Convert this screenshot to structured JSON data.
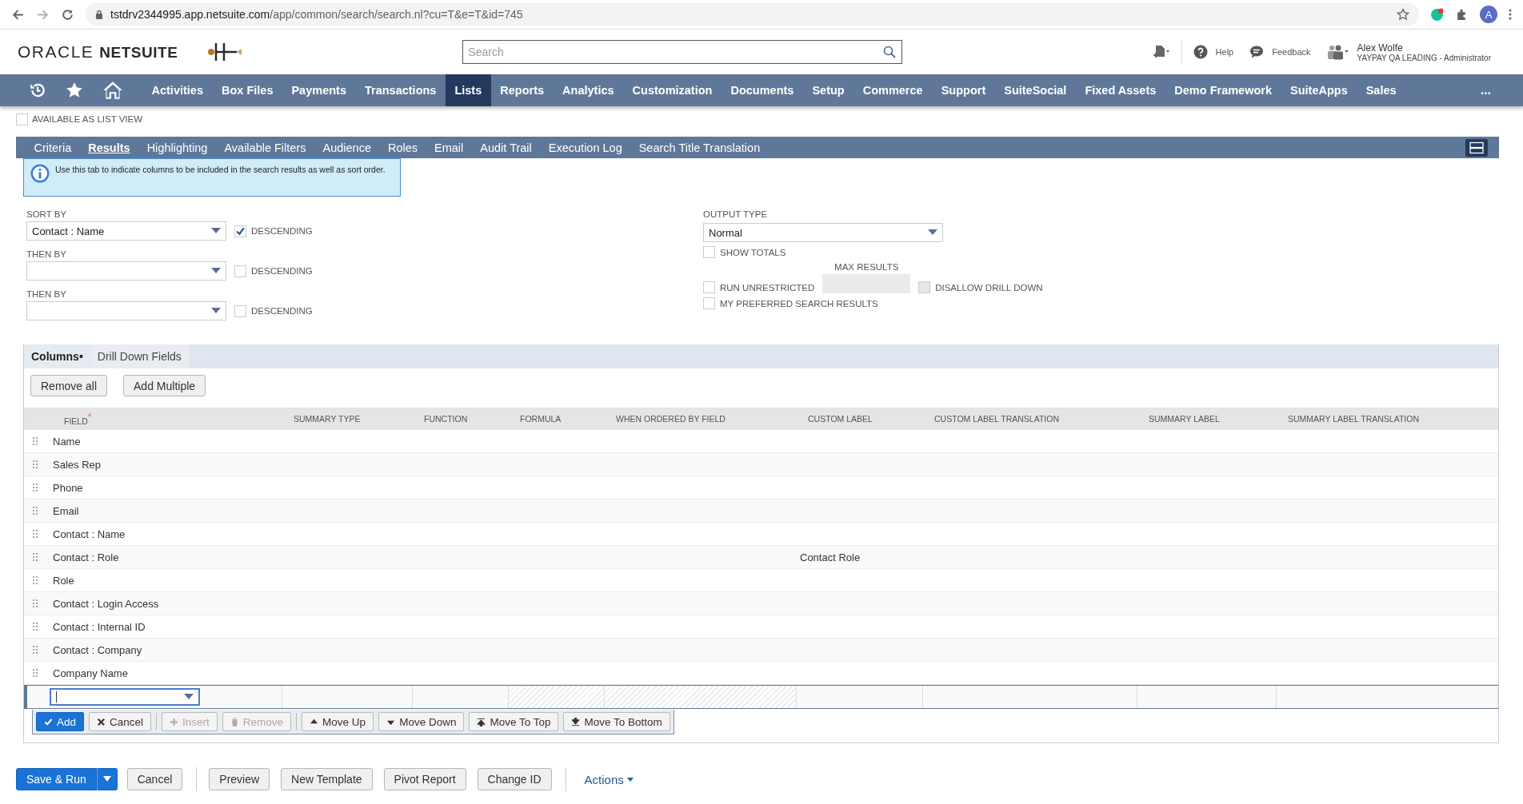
{
  "browser": {
    "url_host": "tstdrv2344995.app.netsuite.com",
    "url_path": "/app/common/search/search.nl?cu=T&e=T&id=745",
    "profile_initial": "A"
  },
  "header": {
    "brand_left": "ORACLE",
    "brand_right": "NETSUITE",
    "search_placeholder": "Search",
    "help": "Help",
    "feedback": "Feedback",
    "user_name": "Alex Wolfe",
    "user_role": "YAYPAY QA LEADING - Administrator"
  },
  "nav": [
    {
      "label": "Activities",
      "selected": false
    },
    {
      "label": "Box Files",
      "selected": false
    },
    {
      "label": "Payments",
      "selected": false
    },
    {
      "label": "Transactions",
      "selected": false
    },
    {
      "label": "Lists",
      "selected": true
    },
    {
      "label": "Reports",
      "selected": false
    },
    {
      "label": "Analytics",
      "selected": false
    },
    {
      "label": "Customization",
      "selected": false
    },
    {
      "label": "Documents",
      "selected": false
    },
    {
      "label": "Setup",
      "selected": false
    },
    {
      "label": "Commerce",
      "selected": false
    },
    {
      "label": "Support",
      "selected": false
    },
    {
      "label": "SuiteSocial",
      "selected": false
    },
    {
      "label": "Fixed Assets",
      "selected": false
    },
    {
      "label": "Demo Framework",
      "selected": false
    },
    {
      "label": "SuiteApps",
      "selected": false
    },
    {
      "label": "Sales",
      "selected": false
    }
  ],
  "nav_more": "...",
  "available_as_list_view": {
    "label": "AVAILABLE AS LIST VIEW",
    "checked": false
  },
  "subtabs": [
    {
      "label": "Criteria",
      "selected": false
    },
    {
      "label": "Results",
      "selected": true
    },
    {
      "label": "Highlighting",
      "selected": false
    },
    {
      "label": "Available Filters",
      "selected": false
    },
    {
      "label": "Audience",
      "selected": false
    },
    {
      "label": "Roles",
      "selected": false
    },
    {
      "label": "Email",
      "selected": false
    },
    {
      "label": "Audit Trail",
      "selected": false
    },
    {
      "label": "Execution Log",
      "selected": false
    },
    {
      "label": "Search Title Translation",
      "selected": false
    }
  ],
  "info": "Use this tab to indicate columns to be included in the search results as well as sort order.",
  "sort_fields": [
    {
      "label": "SORT BY",
      "value": "Contact : Name",
      "descending_label": "DESCENDING",
      "descending": true
    },
    {
      "label": "THEN BY",
      "descending_label": "DESCENDING",
      "descending": false
    },
    {
      "label": "THEN BY",
      "descending_label": "DESCENDING",
      "descending": false
    }
  ],
  "output": {
    "output_type_label": "OUTPUT TYPE",
    "output_type": "Normal",
    "show_totals": {
      "label": "SHOW TOTALS",
      "checked": false
    },
    "max_results_label": "MAX RESULTS",
    "run_unrestricted": {
      "label": "RUN UNRESTRICTED",
      "checked": false
    },
    "disallow_drill_down": {
      "label": "DISALLOW DRILL DOWN",
      "checked": false,
      "disabled": true
    },
    "my_preferred": {
      "label": "MY PREFERRED SEARCH RESULTS",
      "checked": false
    }
  },
  "section_tabs": [
    {
      "label": "Columns",
      "marker": "•",
      "selected": true
    },
    {
      "label": "Drill Down Fields",
      "selected": false
    }
  ],
  "section_buttons": [
    "Remove all",
    "Add Multiple"
  ],
  "table": {
    "columns": [
      {
        "label": "FIELD",
        "required": true
      },
      {
        "label": "SUMMARY TYPE",
        "required": false
      },
      {
        "label": "FUNCTION",
        "required": false
      },
      {
        "label": "FORMULA",
        "required": false
      },
      {
        "label": "WHEN ORDERED BY FIELD",
        "required": false
      },
      {
        "label": "CUSTOM LABEL",
        "required": false
      },
      {
        "label": "CUSTOM LABEL TRANSLATION",
        "required": false
      },
      {
        "label": "SUMMARY LABEL",
        "required": false
      },
      {
        "label": "SUMMARY LABEL TRANSLATION",
        "required": false
      }
    ],
    "required_mark": "*",
    "rows": [
      {
        "field": "Name"
      },
      {
        "field": "Sales Rep"
      },
      {
        "field": "Phone"
      },
      {
        "field": "Email"
      },
      {
        "field": "Contact : Name"
      },
      {
        "field": "Contact : Role",
        "custom_label": "Contact Role"
      },
      {
        "field": "Role"
      },
      {
        "field": "Contact : Login Access"
      },
      {
        "field": "Contact : Internal ID"
      },
      {
        "field": "Contact : Company"
      },
      {
        "field": "Company Name"
      }
    ]
  },
  "edit_buttons": [
    {
      "label": "Add",
      "kind": "check",
      "primary": true,
      "disabled": false
    },
    {
      "label": "Cancel",
      "kind": "cross",
      "primary": false,
      "disabled": false
    },
    {
      "label": "Insert",
      "kind": "plus",
      "primary": false,
      "disabled": true
    },
    {
      "label": "Remove",
      "kind": "trash",
      "primary": false,
      "disabled": true
    },
    {
      "label": "Move Up",
      "kind": "up",
      "primary": false,
      "disabled": false
    },
    {
      "label": "Move Down",
      "kind": "down",
      "primary": false,
      "disabled": false
    },
    {
      "label": "Move To Top",
      "kind": "top",
      "primary": false,
      "disabled": false
    },
    {
      "label": "Move To Bottom",
      "kind": "bottom",
      "primary": false,
      "disabled": false
    }
  ],
  "footer": {
    "save_run": "Save & Run",
    "buttons": [
      "Cancel",
      "Preview",
      "New Template",
      "Pivot Report",
      "Change ID"
    ],
    "actions": "Actions"
  }
}
